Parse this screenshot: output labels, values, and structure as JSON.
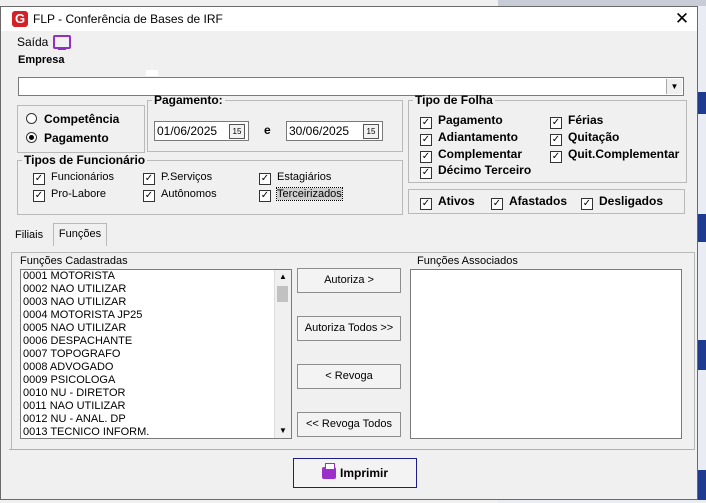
{
  "window": {
    "title": "FLP - Conferência de Bases de IRF",
    "close_glyph": "✕"
  },
  "menu": {
    "saida": "Saída"
  },
  "empresa": {
    "label": "Empresa",
    "value": ""
  },
  "radio": {
    "competencia": "Competência",
    "pagamento": "Pagamento",
    "selected": "Pagamento"
  },
  "pagamento": {
    "legend": "Pagamento:",
    "date_from": "01/06/2025",
    "separator": "e",
    "date_to": "30/06/2025",
    "calendar_glyph": "15"
  },
  "tipos_funcionario": {
    "legend": "Tipos de Funcionário",
    "items": [
      {
        "label": "Funcionários",
        "checked": true
      },
      {
        "label": "P.Serviços",
        "checked": true
      },
      {
        "label": "Estagiários",
        "checked": true
      },
      {
        "label": "Pro-Labore",
        "checked": true
      },
      {
        "label": "Autônomos",
        "checked": true
      },
      {
        "label": "Terceirizados",
        "checked": true
      }
    ]
  },
  "tipo_folha": {
    "legend": "Tipo de Folha",
    "items": [
      {
        "label": "Pagamento",
        "checked": true
      },
      {
        "label": "Férias",
        "checked": true
      },
      {
        "label": "Adiantamento",
        "checked": true
      },
      {
        "label": "Quitação",
        "checked": true
      },
      {
        "label": "Complementar",
        "checked": true
      },
      {
        "label": "Quit.Complementar",
        "checked": true
      },
      {
        "label": "Décimo Terceiro",
        "checked": true
      }
    ]
  },
  "situacao": {
    "items": [
      {
        "label": "Ativos",
        "checked": true
      },
      {
        "label": "Afastados",
        "checked": true
      },
      {
        "label": "Desligados",
        "checked": true
      }
    ]
  },
  "tabs": [
    {
      "label": "Filiais"
    },
    {
      "label": "Funções"
    }
  ],
  "funcoes": {
    "cadastradas_label": "Funções Cadastradas",
    "associados_label": "Funções Associados",
    "cadastradas": [
      "0001 MOTORISTA",
      "0002 NAO UTILIZAR",
      "0003 NAO UTILIZAR",
      "0004 MOTORISTA JP25",
      "0005 NAO UTILIZAR",
      "0006 DESPACHANTE",
      "0007 TOPOGRAFO",
      "0008 ADVOGADO",
      "0009 PSICOLOGA",
      "0010 NU - DIRETOR",
      "0011 NAO UTILIZAR",
      "0012 NU - ANAL. DP",
      "0013 TECNICO INFORM."
    ],
    "associados": []
  },
  "buttons": {
    "autoriza": "Autoriza >",
    "autoriza_todos": "Autoriza Todos >>",
    "revoga": "< Revoga",
    "revoga_todos": "<< Revoga Todos",
    "imprimir": "Imprimir"
  },
  "scroll_glyphs": {
    "up": "▲",
    "down": "▼"
  },
  "combo_glyph": "▼",
  "check_glyph": "✓",
  "colors": {
    "accent_purple": "#9b30c8",
    "logo_red": "#d42027",
    "print_border": "#1d1d8a"
  }
}
